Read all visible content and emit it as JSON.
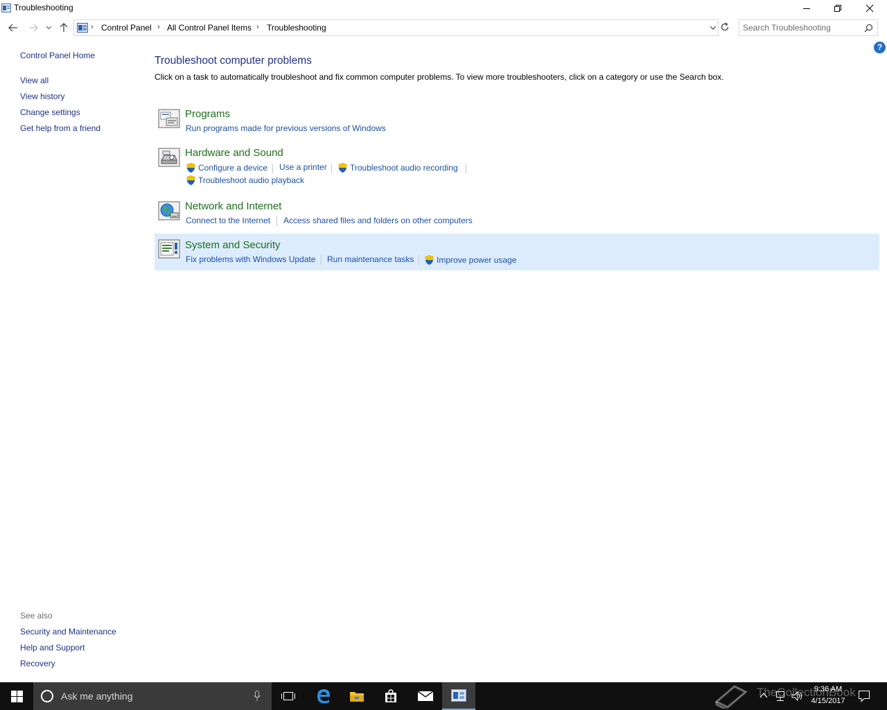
{
  "window": {
    "title": "Troubleshooting"
  },
  "address": {
    "crumbs": [
      "Control Panel",
      "All Control Panel Items",
      "Troubleshooting"
    ],
    "search_placeholder": "Search Troubleshooting"
  },
  "left_pane": {
    "home": "Control Panel Home",
    "links": [
      "View all",
      "View history",
      "Change settings",
      "Get help from a friend"
    ],
    "see_also_label": "See also",
    "see_also": [
      "Security and Maintenance",
      "Help and Support",
      "Recovery"
    ]
  },
  "main": {
    "title": "Troubleshoot computer problems",
    "description": "Click on a task to automatically troubleshoot and fix common computer problems. To view more troubleshooters, click on a category or use the Search box.",
    "categories": [
      {
        "title": "Programs",
        "icon": "programs-icon",
        "tasks": [
          "Run programs made for previous versions of Windows"
        ]
      },
      {
        "title": "Hardware and Sound",
        "icon": "hardware-sound-icon",
        "tasks": [
          "Configure a device",
          "Use a printer",
          "Troubleshoot audio recording",
          "Troubleshoot audio playback"
        ]
      },
      {
        "title": "Network and Internet",
        "icon": "network-icon",
        "tasks": [
          "Connect to the Internet",
          "Access shared files and folders on other computers"
        ]
      },
      {
        "title": "System and Security",
        "icon": "system-security-icon",
        "tasks": [
          "Fix problems with Windows Update",
          "Run maintenance tasks",
          "Improve power usage"
        ]
      }
    ]
  },
  "taskbar": {
    "search_text": "Ask me anything",
    "time": "9:36 AM",
    "date": "4/15/2017",
    "watermark": "TheCollectionBook"
  },
  "colors": {
    "link": "#1e50a2",
    "heading": "#1e3287",
    "category": "#1e6e1e",
    "highlight": "#dcecfc",
    "taskbar": "#101010"
  }
}
